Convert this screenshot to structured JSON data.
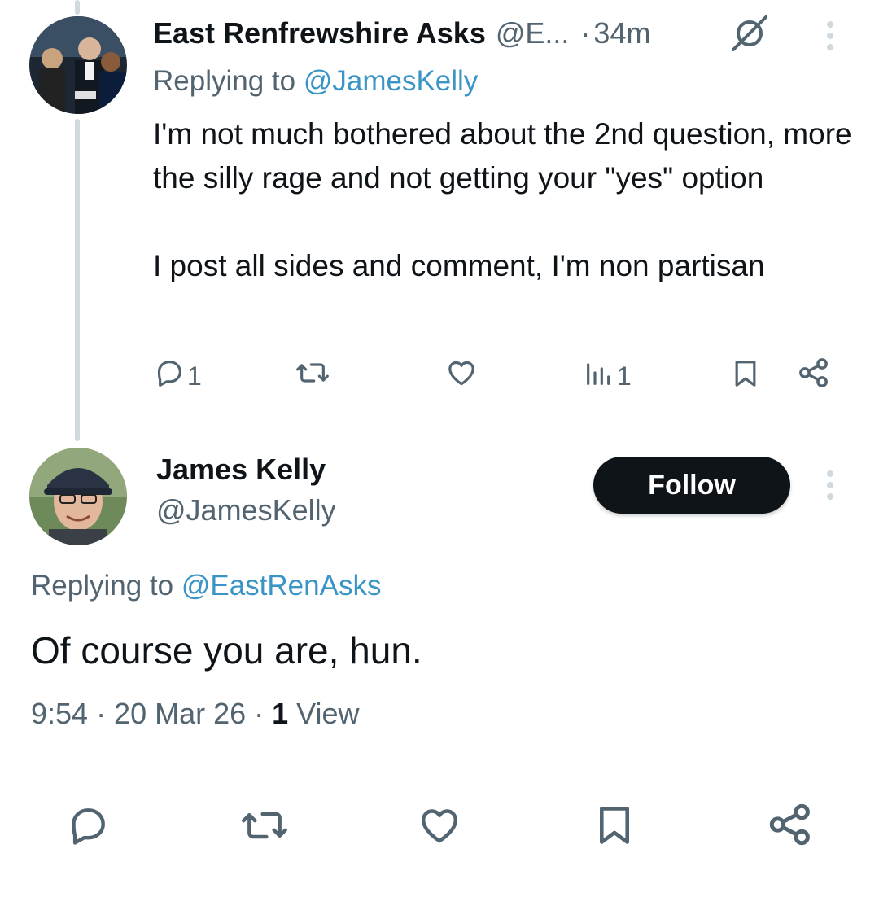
{
  "reply_tweet": {
    "display_name": "East Renfrewshire Asks",
    "handle": "@E...",
    "time_separator": "·",
    "time": "34m",
    "replying_prefix": "Replying to ",
    "replying_to": "@JamesKelly",
    "text_lines": [
      "I'm not much bothered about the 2nd question, more the silly rage and not getting your \"yes\" option",
      "I post all sides and comment, I'm non partisan"
    ],
    "actions": {
      "reply_count": "1",
      "retweet_count": "",
      "like_count": "",
      "views_count": "1"
    }
  },
  "main_tweet": {
    "display_name": "James Kelly",
    "handle": "@JamesKelly",
    "follow_label": "Follow",
    "replying_prefix": "Replying to ",
    "replying_to": "@EastRenAsks",
    "text": "Of course you are, hun.",
    "timestamp": "9:54 · 20 Mar 26 · ",
    "view_count": "1",
    "view_label": " View"
  },
  "icons": {
    "reply": "reply-icon",
    "retweet": "retweet-icon",
    "like": "heart-icon",
    "views": "views-chart-icon",
    "bookmark": "bookmark-icon",
    "share": "share-icon",
    "more": "more-vertical-icon",
    "hidden": "hidden-reply-icon"
  },
  "colors": {
    "text": "#0f1419",
    "secondary": "#536471",
    "link": "#1d9bf0",
    "thread_line": "#cfd9de",
    "follow_bg": "#0f1419"
  }
}
